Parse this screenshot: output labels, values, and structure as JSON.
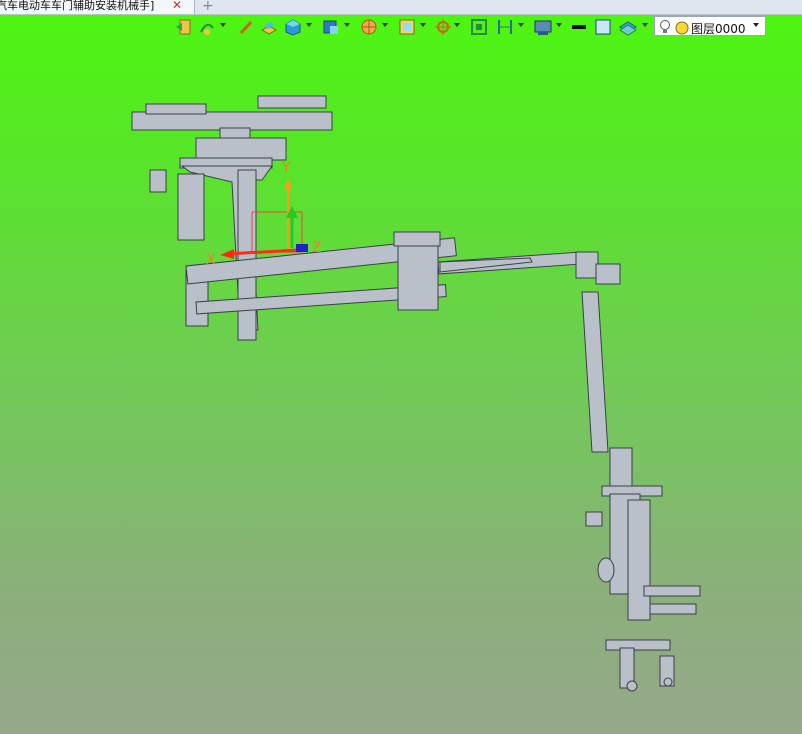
{
  "tab": {
    "title": "汽车电动车车门辅助安装机械手]",
    "close_glyph": "✕",
    "new_glyph": "+"
  },
  "toolbar": {
    "icons": [
      "exit-icon",
      "sketch-icon",
      "pencil-icon",
      "extrude-icon",
      "cube-icon",
      "view-cube-icon",
      "wheel-icon",
      "frame-icon",
      "crosshair-icon",
      "fit-view-icon",
      "dimension-icon",
      "display-icon",
      "line-color-icon",
      "fill-color-icon",
      "layer-stack-icon",
      "lightbulb-icon"
    ],
    "layer": {
      "name": "图层0000"
    }
  },
  "axes": {
    "x": "X",
    "y": "Y",
    "z": "Z"
  },
  "colors": {
    "viewport_top": "#4cf70e",
    "viewport_bottom": "#96a88a",
    "axis_x": "#ff2a1a",
    "axis_y": "#22cc22",
    "axis_label": "#ff7a1a",
    "model": "#b9c0c9"
  }
}
